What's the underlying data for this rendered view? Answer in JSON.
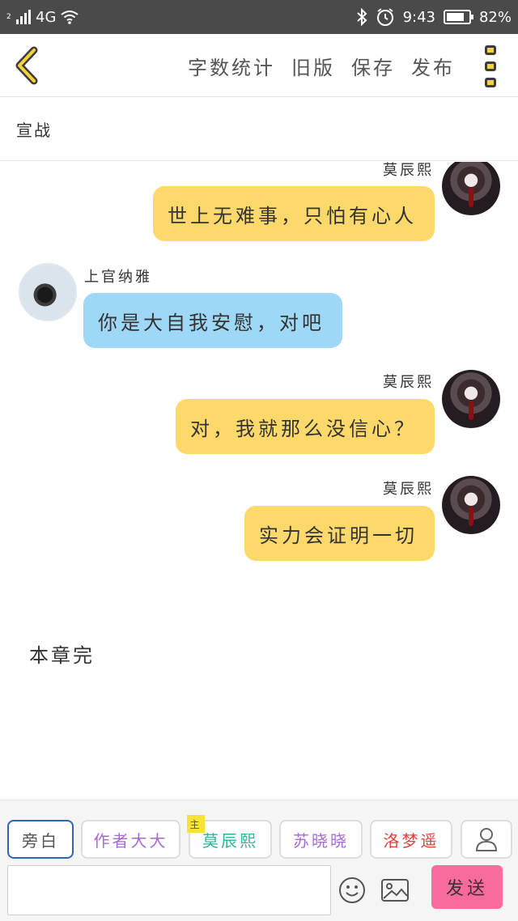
{
  "status_bar": {
    "sim_slot": "2",
    "network": "4G",
    "time": "9:43",
    "battery_percent": "82%",
    "battery_level": 0.82,
    "icons": [
      "signal-icon",
      "wifi-icon",
      "bluetooth-icon",
      "alarm-icon",
      "battery-icon"
    ]
  },
  "header": {
    "back_icon": "chevron-left-icon",
    "actions": {
      "word_count": "字数统计",
      "old_version": "旧版",
      "save": "保存",
      "publish": "发布"
    },
    "menu_icon": "vertical-dots-icon"
  },
  "chapter": {
    "title": "宣战",
    "end_text": "本章完"
  },
  "messages": [
    {
      "side": "right",
      "name": "莫辰熙",
      "text": "世上无难事，只怕有心人",
      "color": "#fcd96a"
    },
    {
      "side": "left",
      "name": "上官纳雅",
      "text": "你是大自我安慰，对吧",
      "color": "#9ed8f6"
    },
    {
      "side": "right",
      "name": "莫辰熙",
      "text": "对，我就那么没信心？",
      "color": "#fcd96a"
    },
    {
      "side": "right",
      "name": "莫辰熙",
      "text": "实力会证明一切",
      "color": "#fcd96a"
    }
  ],
  "roles": {
    "narration": {
      "label": "旁白",
      "color": "#555555"
    },
    "author": {
      "label": "作者大大",
      "color": "#a56bd2"
    },
    "protagonist": {
      "label": "莫辰熙",
      "tag": "主",
      "color": "#2fb3a0"
    },
    "su": {
      "label": "苏晓晓",
      "color": "#a56bd2"
    },
    "luo": {
      "label": "洛梦遥",
      "color": "#e0423a"
    },
    "add_icon": "person-icon"
  },
  "composer": {
    "input_value": "",
    "emoji_icon": "smiley-icon",
    "image_icon": "image-icon",
    "send_label": "发送"
  },
  "colors": {
    "accent_yellow": "#f5d33b",
    "send_pink": "#f96b9c",
    "bubble_yellow": "#fcd96a",
    "bubble_blue": "#9ed8f6"
  }
}
